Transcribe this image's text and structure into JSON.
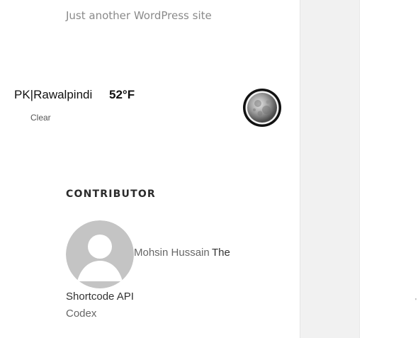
{
  "site": {
    "tagline": "Just another WordPress site"
  },
  "weather": {
    "location": "PK|Rawalpindi",
    "temperature": "52°F",
    "condition": "Clear",
    "icon": "moon-icon"
  },
  "contributor": {
    "heading": "CONTRIBUTOR",
    "name": "Mohsin Hussain",
    "link_line1": "The",
    "link_line2": "Shortcode API",
    "codex": "Codex",
    "avatar_icon": "default-avatar-icon"
  },
  "colors": {
    "sidebar_bg": "#f1f1f1",
    "tagline": "#8a8a8a",
    "heading": "#2b2b2b"
  }
}
